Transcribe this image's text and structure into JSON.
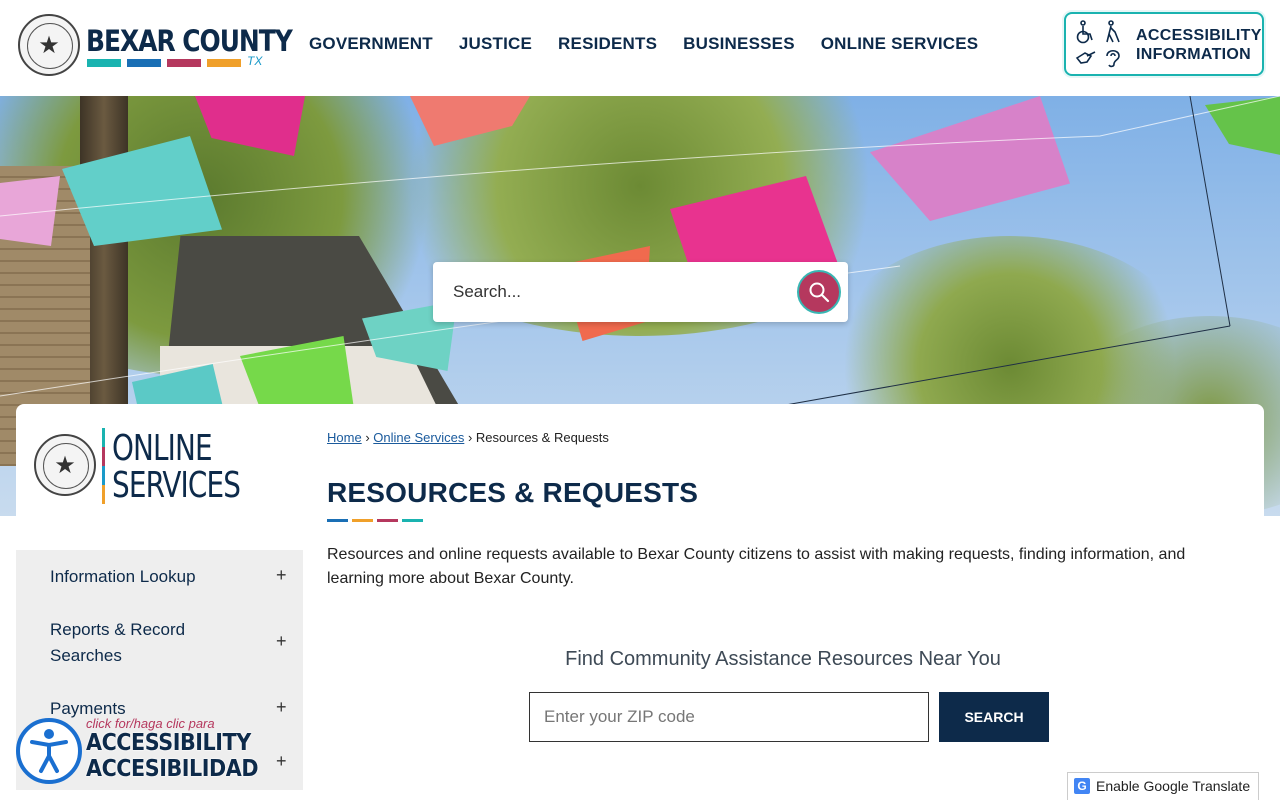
{
  "header": {
    "logo_text": "BEXAR COUNTY",
    "logo_suffix": "TX",
    "logo_bar_colors": [
      "#1ab3b0",
      "#1a6fb5",
      "#b5385e",
      "#f0a02a"
    ],
    "nav": [
      "GOVERNMENT",
      "JUSTICE",
      "RESIDENTS",
      "BUSINESSES",
      "ONLINE SERVICES"
    ],
    "accessibility_button": {
      "line1": "ACCESSIBILITY",
      "line2": "INFORMATION",
      "icons": [
        "wheelchair-icon",
        "blind-person-icon",
        "sign-language-icon",
        "hearing-icon"
      ]
    }
  },
  "hero": {
    "search_placeholder": "Search..."
  },
  "section": {
    "title_line1": "ONLINE",
    "title_line2": "SERVICES"
  },
  "sidebar": {
    "items": [
      {
        "label": "Information Lookup"
      },
      {
        "label": "Reports & Record Searches"
      },
      {
        "label": "Payments"
      },
      {
        "label": ""
      }
    ]
  },
  "breadcrumb": {
    "home": "Home",
    "separator": "›",
    "parent": "Online Services",
    "current": "Resources & Requests"
  },
  "page": {
    "title": "RESOURCES & REQUESTS",
    "title_bar_colors": [
      "#1a6fb5",
      "#f0a02a",
      "#b5385e",
      "#1ab3b0"
    ],
    "description": "Resources and online requests available to Bexar County citizens to assist with making requests, finding information, and learning more about Bexar County."
  },
  "finder": {
    "title": "Find Community Assistance Resources Near You",
    "zip_placeholder": "Enter your ZIP code",
    "button_label": "SEARCH"
  },
  "accessibility_widget": {
    "small": "click for/haga clic para",
    "line1": "ACCESSIBILITY",
    "line2": "ACCESIBILIDAD"
  },
  "translate": {
    "label": "Enable Google Translate"
  },
  "colors": {
    "navy": "#0d2a4a",
    "teal": "#1ab3b0",
    "magenta": "#b5385e"
  }
}
